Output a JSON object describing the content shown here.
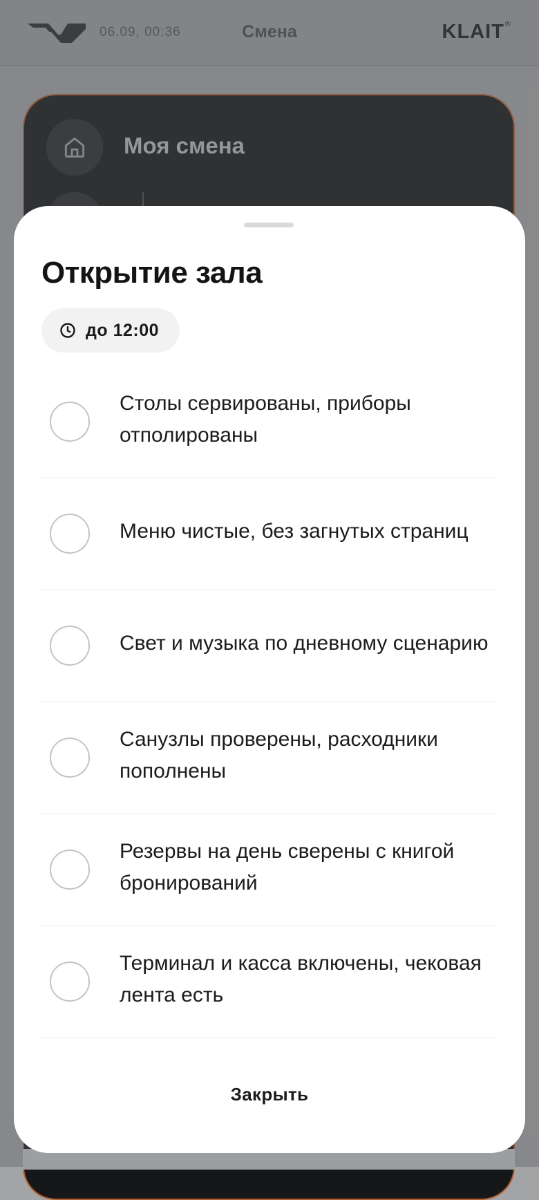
{
  "header": {
    "datetime": "06.09, 00:36",
    "title": "Смена",
    "brand": "KLAIT",
    "brand_mark": "®"
  },
  "background_card": {
    "title": "Моя смена",
    "icon": "home-icon"
  },
  "sheet": {
    "title": "Открытие зала",
    "deadline": {
      "icon": "clock-icon",
      "text": "до 12:00"
    },
    "items": [
      {
        "label": "Столы сервированы, приборы отполированы",
        "checked": false
      },
      {
        "label": "Меню чистые, без загнутых страниц",
        "checked": false
      },
      {
        "label": "Свет и музыка по дневному сценарию",
        "checked": false
      },
      {
        "label": "Санузлы проверены, расходники пополнены",
        "checked": false
      },
      {
        "label": "Резервы на день сверены с книгой бронирований",
        "checked": false
      },
      {
        "label": "Терминал и касса включены, чековая лента есть",
        "checked": false
      }
    ],
    "close_label": "Закрыть"
  },
  "colors": {
    "card_border": "#b35c2e",
    "card_background": "#161718",
    "sheet_background": "#ffffff"
  }
}
